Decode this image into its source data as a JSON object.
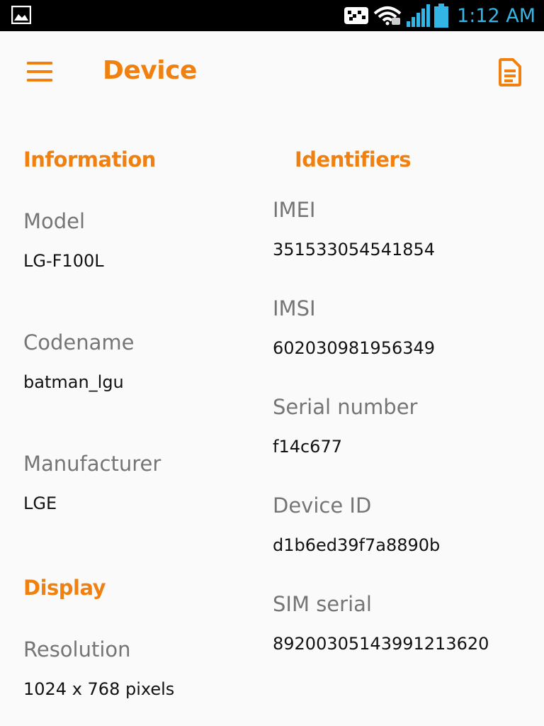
{
  "status_bar": {
    "time": "1:12 AM",
    "icons": [
      "gallery-icon",
      "accessibility-icon",
      "wifi-icon",
      "signal-icon",
      "battery-icon"
    ],
    "accent_color": "#33b5e5"
  },
  "app_bar": {
    "title": "Device",
    "menu_icon": "hamburger-menu-icon",
    "action_icon": "document-icon",
    "accent_color": "#f08010"
  },
  "information": {
    "header": "Information",
    "items": [
      {
        "label": "Model",
        "value": "LG-F100L"
      },
      {
        "label": "Codename",
        "value": "batman_lgu"
      },
      {
        "label": "Manufacturer",
        "value": "LGE"
      }
    ]
  },
  "display": {
    "header": "Display",
    "items": [
      {
        "label": "Resolution",
        "value": "1024 x 768 pixels"
      }
    ]
  },
  "identifiers": {
    "header": "Identifiers",
    "items": [
      {
        "label": "IMEI",
        "value": "351533054541854"
      },
      {
        "label": "IMSI",
        "value": "602030981956349"
      },
      {
        "label": "Serial number",
        "value": "f14c677"
      },
      {
        "label": "Device ID",
        "value": "d1b6ed39f7a8890b"
      },
      {
        "label": "SIM serial",
        "value": "89200305143991213620"
      }
    ]
  }
}
